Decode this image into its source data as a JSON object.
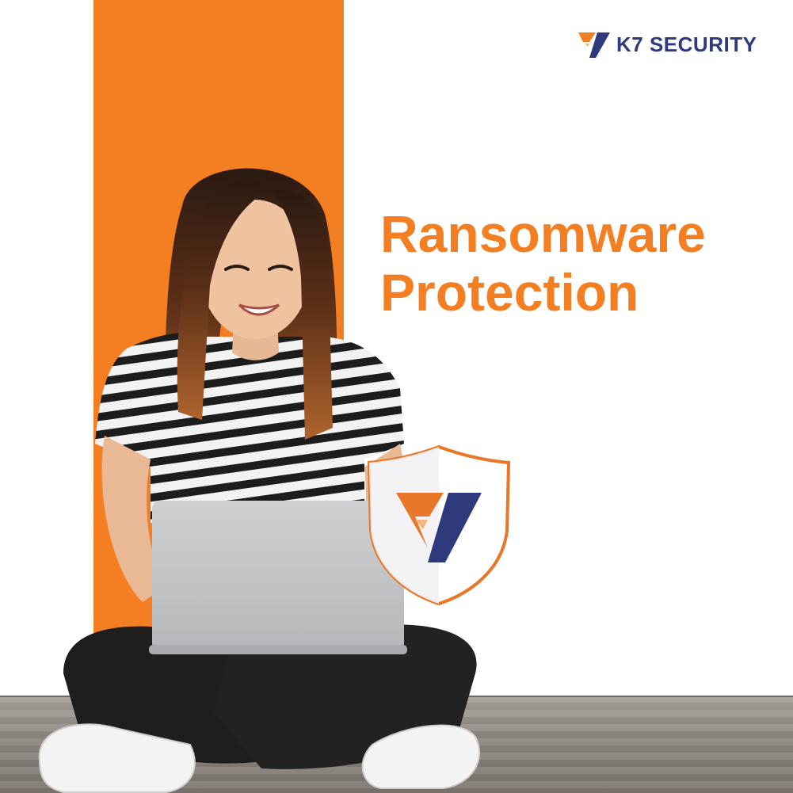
{
  "brand": {
    "name": "K7 SECURITY",
    "logo_icon": "k7-logo-icon",
    "colors": {
      "orange": "#F47F22",
      "navy": "#2E3A7B"
    }
  },
  "headline": {
    "line1": "Ransomware",
    "line2": "Protection",
    "color": "#F47F22"
  },
  "badge": {
    "icon": "k7-shield-icon"
  }
}
